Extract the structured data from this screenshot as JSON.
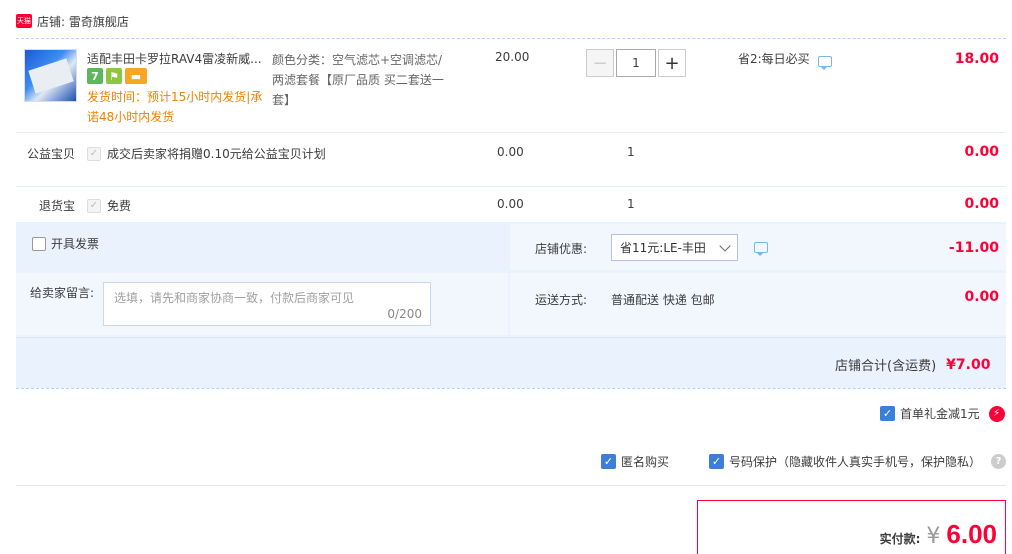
{
  "shop": {
    "badge": "天猫",
    "name": "店铺: 雷奇旗舰店"
  },
  "item": {
    "title": "适配丰田卡罗拉RAV4雷凌新威...",
    "icons": [
      "7",
      "⚑",
      "▬"
    ],
    "ship_time": "发货时间：预计15小时内发货|承诺48小时内发货",
    "sku": "颜色分类：空气滤芯+空调滤芯/两滤套餐【原厂品质 买二套送一套】",
    "price": "20.00",
    "qty_minus": "−",
    "qty_value": "1",
    "qty_plus": "+",
    "promo": "省2:每日必买",
    "amount": "18.00"
  },
  "charity": {
    "label": "公益宝贝",
    "desc": "成交后卖家将捐赠0.10元给公益宝贝计划",
    "price": "0.00",
    "qty": "1",
    "amount": "0.00"
  },
  "returns": {
    "label": "退货宝",
    "desc": "免费",
    "price": "0.00",
    "qty": "1",
    "amount": "0.00"
  },
  "invoice": {
    "label": "开具发票"
  },
  "shop_discount": {
    "label": "店铺优惠:",
    "selected": "省11元:LE-丰田",
    "amount": "-11.00"
  },
  "message": {
    "label": "给卖家留言:",
    "placeholder": "选填，请先和商家协商一致，付款后商家可见",
    "counter": "0/200"
  },
  "shipping": {
    "label": "运送方式:",
    "value": "普通配送 快递 包邮",
    "amount": "0.00"
  },
  "shop_total": {
    "label": "店铺合计(含运费)",
    "amount": "¥7.00"
  },
  "first_order": {
    "label": "首单礼金减1元",
    "icon": "⚡"
  },
  "anonymous": {
    "label": "匿名购买"
  },
  "privacy": {
    "label": "号码保护（隐藏收件人真实手机号，保护隐私）",
    "help": "?"
  },
  "pay": {
    "label": "实付款:",
    "yen": "¥",
    "amount": "6.00"
  },
  "colors": {
    "accent": "#ff0036",
    "blue_bg": "#eaf2fe",
    "check_blue": "#3d7fd6"
  }
}
